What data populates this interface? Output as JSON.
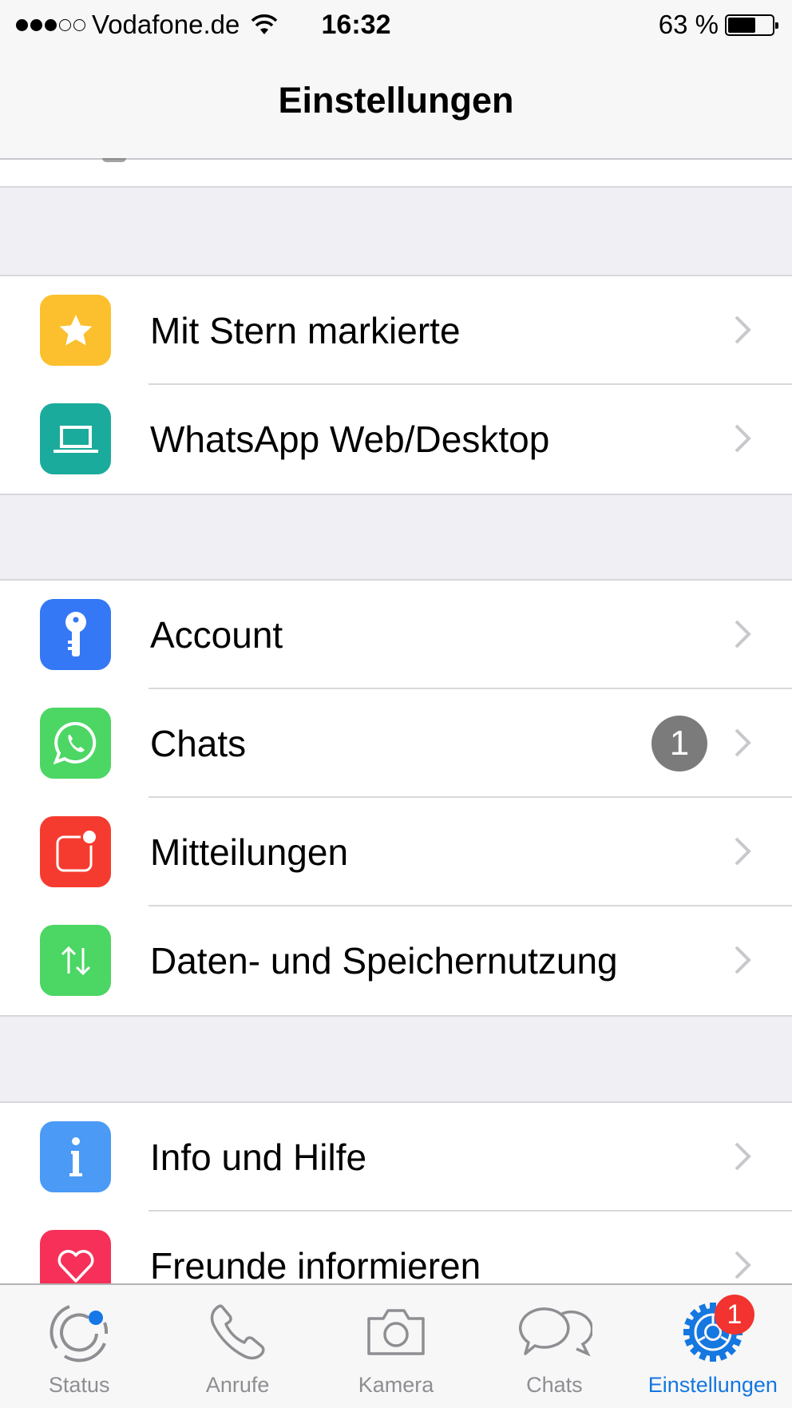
{
  "status_bar": {
    "signal_bars_filled": 3,
    "signal_bars_total": 5,
    "carrier": "Vodafone.de",
    "wifi_icon": "wifi-icon",
    "time": "16:32",
    "battery_text": "63 %",
    "battery_level_percent": 63
  },
  "nav": {
    "title": "Einstellungen"
  },
  "groups": [
    {
      "items": [
        {
          "label": "Mit Stern markierte",
          "icon": "star-icon",
          "icon_color": "#fcc02e"
        },
        {
          "label": "WhatsApp Web/Desktop",
          "icon": "laptop-icon",
          "icon_color": "#1aab9c"
        }
      ]
    },
    {
      "items": [
        {
          "label": "Account",
          "icon": "key-icon",
          "icon_color": "#3478f6"
        },
        {
          "label": "Chats",
          "icon": "whatsapp-icon",
          "icon_color": "#4cd664",
          "badge": "1"
        },
        {
          "label": "Mitteilungen",
          "icon": "notification-icon",
          "icon_color": "#f53b30"
        },
        {
          "label": "Daten- und Speichernutzung",
          "icon": "data-arrows-icon",
          "icon_color": "#4cd664"
        }
      ]
    },
    {
      "items": [
        {
          "label": "Info und Hilfe",
          "icon": "info-icon",
          "icon_color": "#4a9af6"
        },
        {
          "label": "Freunde informieren",
          "icon": "heart-icon",
          "icon_color": "#f63058"
        }
      ]
    }
  ],
  "tab_bar": {
    "active_color": "#1577e0",
    "inactive_color": "#8e8e93",
    "tabs": [
      {
        "label": "Status",
        "icon": "status-icon",
        "has_dot": true
      },
      {
        "label": "Anrufe",
        "icon": "phone-icon"
      },
      {
        "label": "Kamera",
        "icon": "camera-icon"
      },
      {
        "label": "Chats",
        "icon": "chats-icon"
      },
      {
        "label": "Einstellungen",
        "icon": "settings-gear-icon",
        "active": true,
        "badge": "1"
      }
    ]
  }
}
